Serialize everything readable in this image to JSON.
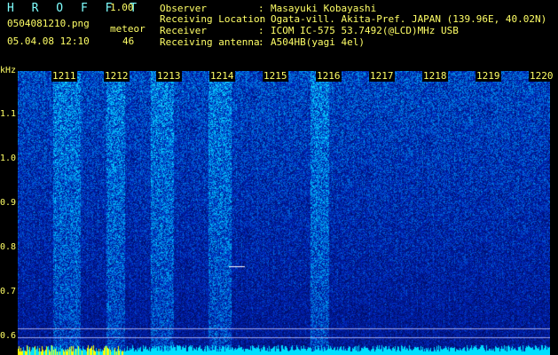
{
  "header": {
    "brand": "H R O F F T",
    "version": "1.00",
    "filename": "0504081210.png",
    "meteor_label": "meteor",
    "datetime": "05.04.08 12:10",
    "meteor_count": "46",
    "info": [
      {
        "label": "Observer",
        "value": "Masayuki Kobayashi"
      },
      {
        "label": "Receiving Location",
        "value": "Ogata-vill. Akita-Pref. JAPAN (139.96E, 40.02N)"
      },
      {
        "label": "Receiver",
        "value": "ICOM IC-575 53.7492(@LCD)MHz USB"
      },
      {
        "label": "Receiving antenna",
        "value": "A504HB(yagi 4el)"
      }
    ],
    "separator": ":"
  },
  "axis": {
    "y_unit": "kHz",
    "y_ticks": [
      "1.1",
      "1.0",
      "0.9",
      "0.8",
      "0.7",
      "0.6"
    ],
    "x_ticks": [
      "1211",
      "1212",
      "1213",
      "1214",
      "1215",
      "1216",
      "1217",
      "1218",
      "1219",
      "1220"
    ]
  },
  "colors": {
    "background": "#000000",
    "header_text": "#ffff66",
    "brand_text": "#7fffff",
    "spectrum_low": "#000050",
    "spectrum_mid": "#1a5cff",
    "spectrum_high": "#7fffff",
    "signal_hot": "#ffff00"
  }
}
